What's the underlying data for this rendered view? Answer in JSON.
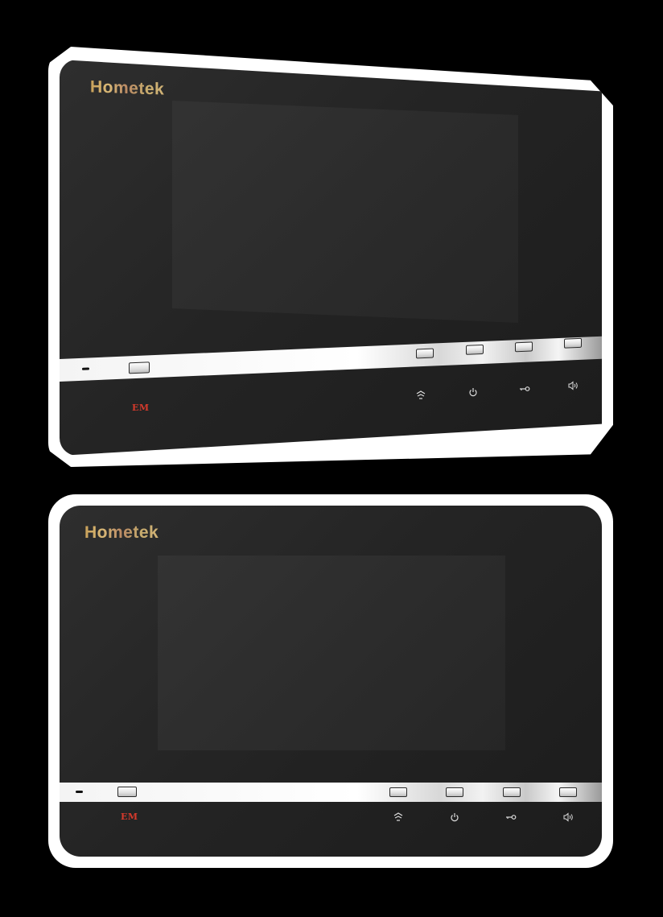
{
  "units": [
    {
      "brand": "Hometek",
      "em_label": "EM"
    },
    {
      "brand": "Hometek",
      "em_label": "EM"
    }
  ],
  "icons": [
    "monitor-icon",
    "power-icon",
    "key-icon",
    "speaker-icon"
  ],
  "colors": {
    "background": "#000000",
    "frame": "#ffffff",
    "face": "#262626",
    "brand_gold": "#c9a25a",
    "em_red": "#d63a2c"
  }
}
